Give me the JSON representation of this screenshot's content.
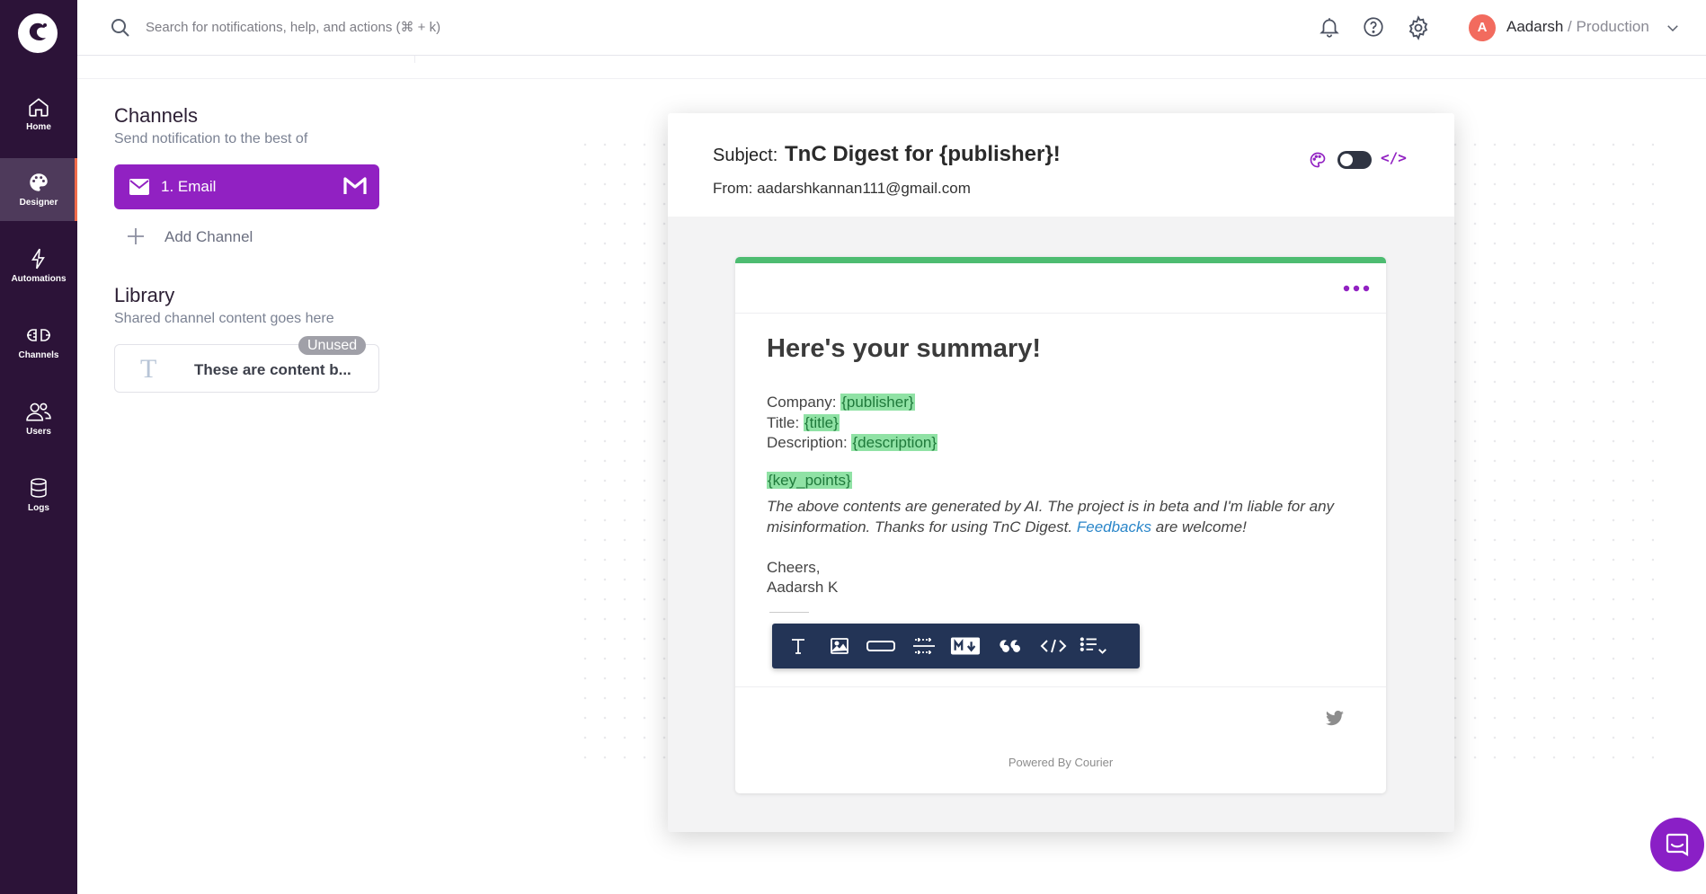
{
  "nav": {
    "items": [
      {
        "label": "Home",
        "icon": "home-icon"
      },
      {
        "label": "Designer",
        "icon": "palette-icon"
      },
      {
        "label": "Automations",
        "icon": "lightning-icon"
      },
      {
        "label": "Channels",
        "icon": "plug-icon"
      },
      {
        "label": "Users",
        "icon": "users-icon"
      },
      {
        "label": "Logs",
        "icon": "database-icon"
      }
    ],
    "active": "Designer"
  },
  "topbar": {
    "search_placeholder": "Search for notifications, help, and actions (⌘ + k)",
    "avatar_initial": "A",
    "user_name": "Aadarsh",
    "separator": " / ",
    "environment": "Production"
  },
  "channels": {
    "title": "Channels",
    "subtitle": "Send notification to the best of",
    "email_label": "1.  Email",
    "add_channel": "Add Channel"
  },
  "library": {
    "title": "Library",
    "subtitle": "Shared channel content goes here",
    "card_text": "These are content b...",
    "badge": "Unused"
  },
  "editor": {
    "subject_label": "Subject:",
    "subject_value": "TnC Digest for {publisher}!",
    "from_line": "From: aadarshkannan111@gmail.com",
    "code_toggle": "</>",
    "email": {
      "heading": "Here's your summary!",
      "company_label": "Company: ",
      "company_var": "{publisher}",
      "title_label": "Title: ",
      "title_var": "{title}",
      "description_label": "Description: ",
      "description_var": "{description}",
      "key_points_var": "{key_points}",
      "disclaimer_before": "The above contents are generated by AI. The project is in beta and I'm liable for any misinformation. Thanks for using TnC Digest. ",
      "disclaimer_link": "Feedbacks",
      "disclaimer_after": " are welcome!",
      "sign_off": "Cheers,",
      "signature": "Aadarsh K",
      "powered_by": "Powered By Courier"
    },
    "toolbar": [
      "text-block",
      "image-block",
      "button-block",
      "divider-block",
      "markdown-block",
      "quote-block",
      "html-block",
      "list-block"
    ]
  },
  "colors": {
    "sidebar": "#2c1338",
    "accent": "#9121c2",
    "header_bar": "#4dbc71",
    "toolbar": "#233456"
  }
}
